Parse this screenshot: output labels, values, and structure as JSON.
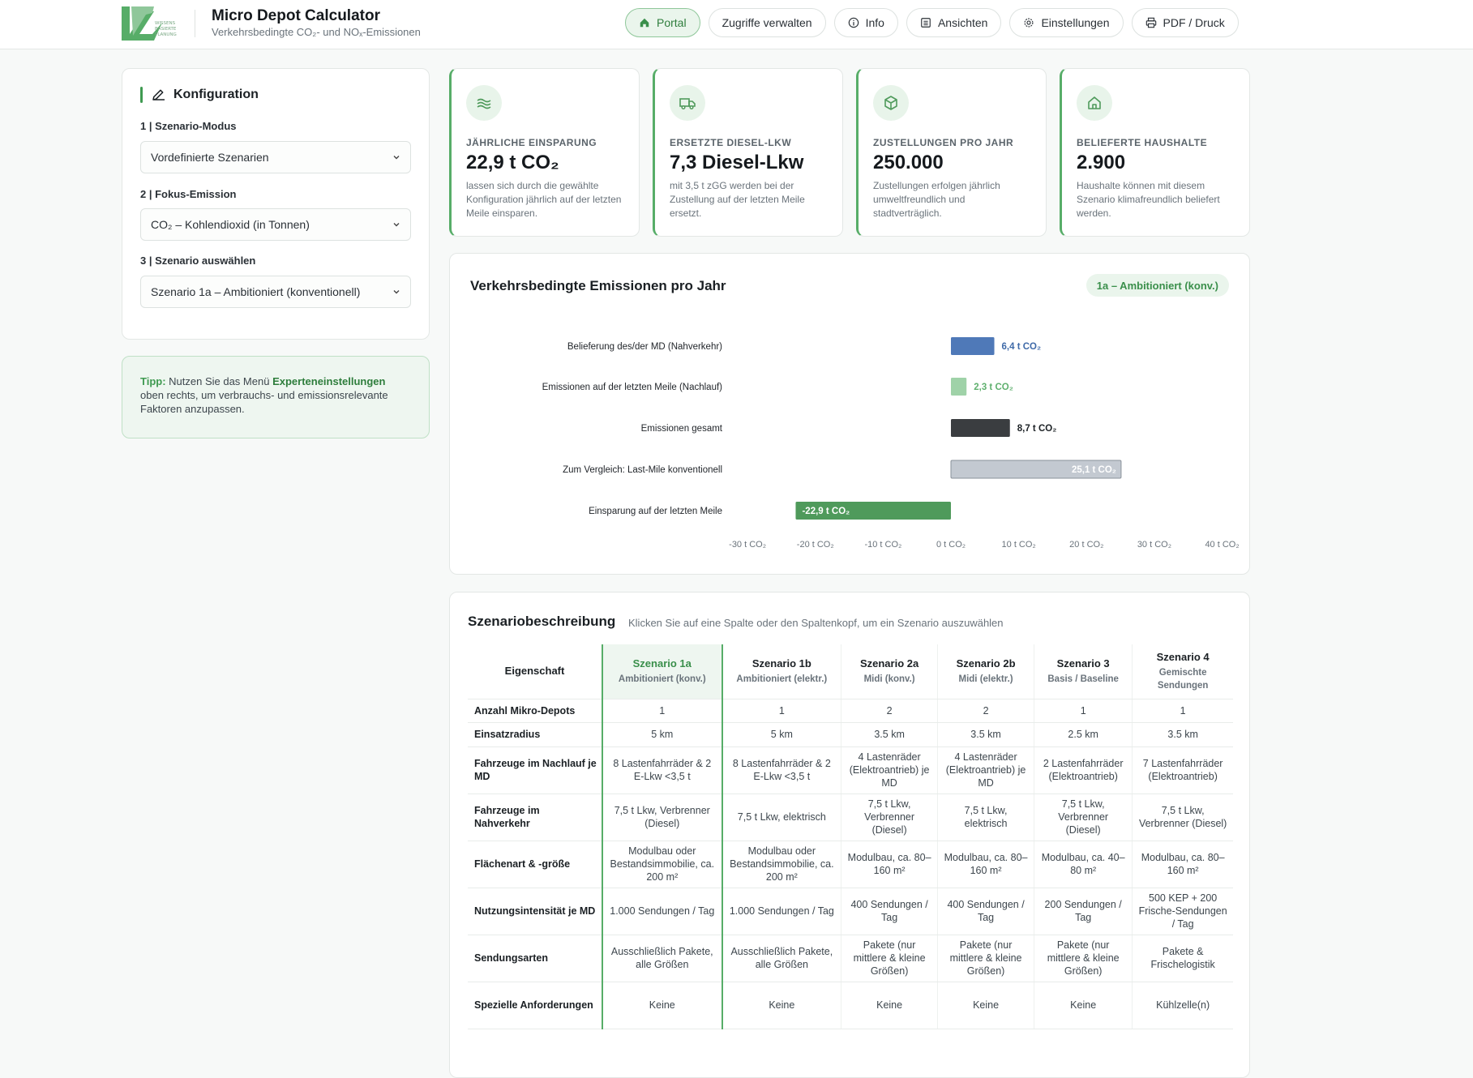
{
  "header": {
    "logo_text": "WISSENS BASIERTE PLANUNG",
    "title": "Micro Depot Calculator",
    "subtitle": "Verkehrsbedingte CO₂- und NOₓ-Emissionen",
    "nav": [
      {
        "label": "Portal",
        "icon": "home-icon",
        "active": true
      },
      {
        "label": "Zugriffe verwalten",
        "icon": "",
        "active": false
      },
      {
        "label": "Info",
        "icon": "info-icon",
        "active": false
      },
      {
        "label": "Ansichten",
        "icon": "list-icon",
        "active": false
      },
      {
        "label": "Einstellungen",
        "icon": "gear-icon",
        "active": false
      },
      {
        "label": "PDF / Druck",
        "icon": "printer-icon",
        "active": false
      }
    ]
  },
  "config": {
    "title": "Konfiguration",
    "fields": [
      {
        "label": "1 | Szenario-Modus",
        "value": "Vordefinierte Szenarien"
      },
      {
        "label": "2 | Fokus-Emission",
        "value": "CO₂ – Kohlendioxid (in Tonnen)"
      },
      {
        "label": "3 | Szenario auswählen",
        "value": "Szenario 1a – Ambitioniert (konventionell)"
      }
    ]
  },
  "tip": {
    "prefix": "Tipp:",
    "text1": " Nutzen Sie das Menü ",
    "link": "Experteneinstellungen",
    "text2": " oben rechts, um verbrauchs- und emissionsrelevante Faktoren anzupassen."
  },
  "kpis": [
    {
      "icon": "wind-icon",
      "label": "JÄHRLICHE EINSPARUNG",
      "value": "22,9 t CO₂",
      "desc": "lassen sich durch die gewählte Konfiguration jährlich auf der letzten Meile einsparen."
    },
    {
      "icon": "truck-icon",
      "label": "ERSETZTE DIESEL-LKW",
      "value": "7,3 Diesel-Lkw",
      "desc": "mit 3,5 t zGG werden bei der Zustellung auf der letzten Meile ersetzt."
    },
    {
      "icon": "box-icon",
      "label": "ZUSTELLUNGEN PRO JAHR",
      "value": "250.000",
      "desc": "Zustellungen erfolgen jährlich umweltfreundlich und stadtverträglich."
    },
    {
      "icon": "house-icon",
      "label": "BELIEFERTE HAUSHALTE",
      "value": "2.900",
      "desc": "Haushalte können mit diesem Szenario klimafreundlich beliefert werden."
    }
  ],
  "chart": {
    "title": "Verkehrsbedingte Emissionen pro Jahr",
    "badge": "1a – Ambitioniert (konv.)"
  },
  "chart_data": {
    "type": "bar",
    "orientation": "horizontal",
    "categories": [
      "Belieferung des/der MD (Nahverkehr)",
      "Emissionen auf der letzten Meile (Nachlauf)",
      "Emissionen gesamt",
      "Zum Vergleich: Last-Mile konventionell",
      "Einsparung auf der letzten Meile"
    ],
    "values": [
      6.4,
      2.3,
      8.7,
      25.1,
      -22.9
    ],
    "value_labels": [
      "6,4 t CO₂",
      "2,3 t CO₂",
      "8,7 t CO₂",
      "25,1 t CO₂",
      "-22,9 t CO₂"
    ],
    "colors": [
      "#4f79b8",
      "#9fd2a8",
      "#3a3d40",
      "#c3c9d1",
      "#4f9a5b"
    ],
    "label_colors": [
      "#3f6aa8",
      "#5fb06e",
      "#1b2024",
      "#ffffff",
      "#ffffff"
    ],
    "label_inside": [
      false,
      false,
      false,
      true,
      true
    ],
    "xlim": [
      -33,
      44
    ],
    "ticks": [
      -30,
      -20,
      -10,
      0,
      10,
      20,
      30,
      40
    ],
    "tick_labels": [
      "-30 t CO₂",
      "-20 t CO₂",
      "-10 t CO₂",
      "0 t CO₂",
      "10 t CO₂",
      "20 t CO₂",
      "30 t CO₂",
      "40 t CO₂"
    ],
    "grid": false,
    "legend": "none"
  },
  "table": {
    "title": "Szenariobeschreibung",
    "hint": "Klicken Sie auf eine Spalte oder den Spaltenkopf, um ein Szenario auszuwählen",
    "property_header": "Eigenschaft",
    "selected_index": 0,
    "columns": [
      {
        "name": "Szenario 1a",
        "sub": "Ambitioniert (konv.)"
      },
      {
        "name": "Szenario 1b",
        "sub": "Ambitioniert (elektr.)"
      },
      {
        "name": "Szenario 2a",
        "sub": "Midi (konv.)"
      },
      {
        "name": "Szenario 2b",
        "sub": "Midi (elektr.)"
      },
      {
        "name": "Szenario 3",
        "sub": "Basis / Baseline"
      },
      {
        "name": "Szenario 4",
        "sub": "Gemischte Sendungen"
      }
    ],
    "rows": [
      {
        "prop": "Anzahl Mikro-Depots",
        "cells": [
          "1",
          "1",
          "2",
          "2",
          "1",
          "1"
        ]
      },
      {
        "prop": "Einsatzradius",
        "cells": [
          "5 km",
          "5 km",
          "3.5 km",
          "3.5 km",
          "2.5 km",
          "3.5 km"
        ]
      },
      {
        "prop": "Fahrzeuge im Nachlauf je MD",
        "cells": [
          "8 Lastenfahrräder & 2 E-Lkw <3,5 t",
          "8 Lastenfahrräder & 2 E-Lkw <3,5 t",
          "4 Lastenräder (Elektroantrieb) je MD",
          "4 Lastenräder (Elektroantrieb) je MD",
          "2 Lastenfahrräder (Elektroantrieb)",
          "7 Lastenfahrräder (Elektroantrieb)"
        ]
      },
      {
        "prop": "Fahrzeuge im Nahverkehr",
        "cells": [
          "7,5 t Lkw, Verbrenner (Diesel)",
          "7,5 t Lkw, elektrisch",
          "7,5 t Lkw, Verbrenner (Diesel)",
          "7,5 t Lkw, elektrisch",
          "7,5 t Lkw, Verbrenner (Diesel)",
          "7,5 t Lkw, Verbrenner (Diesel)"
        ]
      },
      {
        "prop": "Flächenart & -größe",
        "cells": [
          "Modulbau oder Bestandsimmobilie, ca. 200 m²",
          "Modulbau oder Bestandsimmobilie, ca. 200 m²",
          "Modulbau, ca. 80–160 m²",
          "Modulbau, ca. 80–160 m²",
          "Modulbau, ca. 40–80 m²",
          "Modulbau, ca. 80–160 m²"
        ]
      },
      {
        "prop": "Nutzungsintensität je MD",
        "cells": [
          "1.000 Sendungen / Tag",
          "1.000 Sendungen / Tag",
          "400 Sendungen / Tag",
          "400 Sendungen / Tag",
          "200 Sendungen / Tag",
          "500 KEP + 200 Frische-Sendungen / Tag"
        ]
      },
      {
        "prop": "Sendungsarten",
        "cells": [
          "Ausschließlich Pakete, alle Größen",
          "Ausschließlich Pakete, alle Größen",
          "Pakete (nur mittlere & kleine Größen)",
          "Pakete (nur mittlere & kleine Größen)",
          "Pakete (nur mittlere & kleine Größen)",
          "Pakete & Frischelogistik"
        ]
      },
      {
        "prop": "Spezielle Anforderungen",
        "cells": [
          "Keine",
          "Keine",
          "Keine",
          "Keine",
          "Keine",
          "Kühlzelle(n)"
        ]
      }
    ]
  },
  "colors": {
    "accent": "#3f9a51",
    "accent_light": "#eaf5ec"
  }
}
